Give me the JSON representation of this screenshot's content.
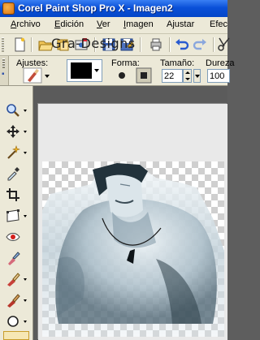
{
  "window": {
    "title": "Corel Paint Shop Pro X - Imagen2"
  },
  "menu": [
    {
      "label": "Archivo",
      "key": "A",
      "rest": "rchivo"
    },
    {
      "label": "Edición",
      "key": "E",
      "rest": "dición"
    },
    {
      "label": "Ver",
      "key": "V",
      "rest": "er"
    },
    {
      "label": "Imagen",
      "key": "I",
      "rest": "magen"
    },
    {
      "label": "Ajustar",
      "key": "j",
      "pre": "A",
      "rest": "ustar"
    },
    {
      "label": "Efec",
      "key": "",
      "rest": "Efec"
    }
  ],
  "options": {
    "presets_label": "Ajustes:",
    "shape_label": "Forma:",
    "size_label": "Tamaño:",
    "size_value": "22",
    "density_label": "Dureza",
    "density_value": "100",
    "color": "#000000"
  },
  "document": {
    "caption": "Gra-Designs"
  },
  "colors": {
    "titlebar": "#0a50d8",
    "chrome": "#ece9d8",
    "workspace": "#5b5b5b",
    "active_tool": "#f6e7b4"
  }
}
